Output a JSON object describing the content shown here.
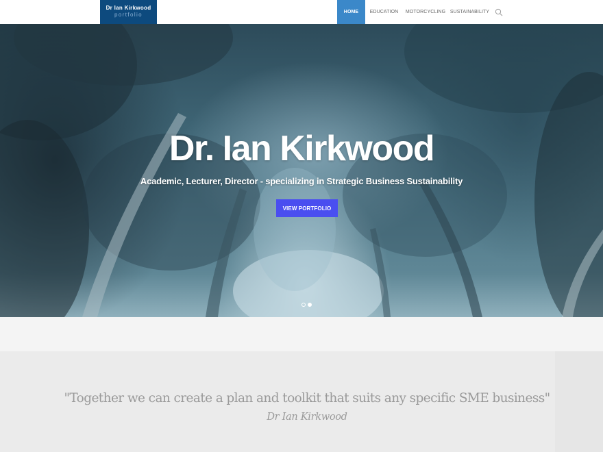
{
  "header": {
    "logo": {
      "title": "Dr Ian Kirkwood",
      "subtitle": "portfolio"
    },
    "nav": [
      {
        "label": "HOME",
        "active": true
      },
      {
        "label": "EDUCATION",
        "active": false
      },
      {
        "label": "MOTORCYCLING",
        "active": false
      },
      {
        "label": "SUSTAINABILITY",
        "active": false
      }
    ],
    "search_icon": "search-icon"
  },
  "hero": {
    "title": "Dr. Ian Kirkwood",
    "subtitle": "Academic, Lecturer, Director - specializing in Strategic Business Sustainability",
    "button_label": "VIEW PORTFOLIO",
    "slides": 2,
    "active_slide": 2
  },
  "quote": {
    "text": "\"Together we can create a plan and toolkit that suits any specific SME business\"",
    "author": "Dr Ian Kirkwood"
  },
  "colors": {
    "logo_bg": "#0d4a7e",
    "nav_active": "#3b88c9",
    "button": "#4a4ef0",
    "quote_text": "#9a9a9a"
  }
}
